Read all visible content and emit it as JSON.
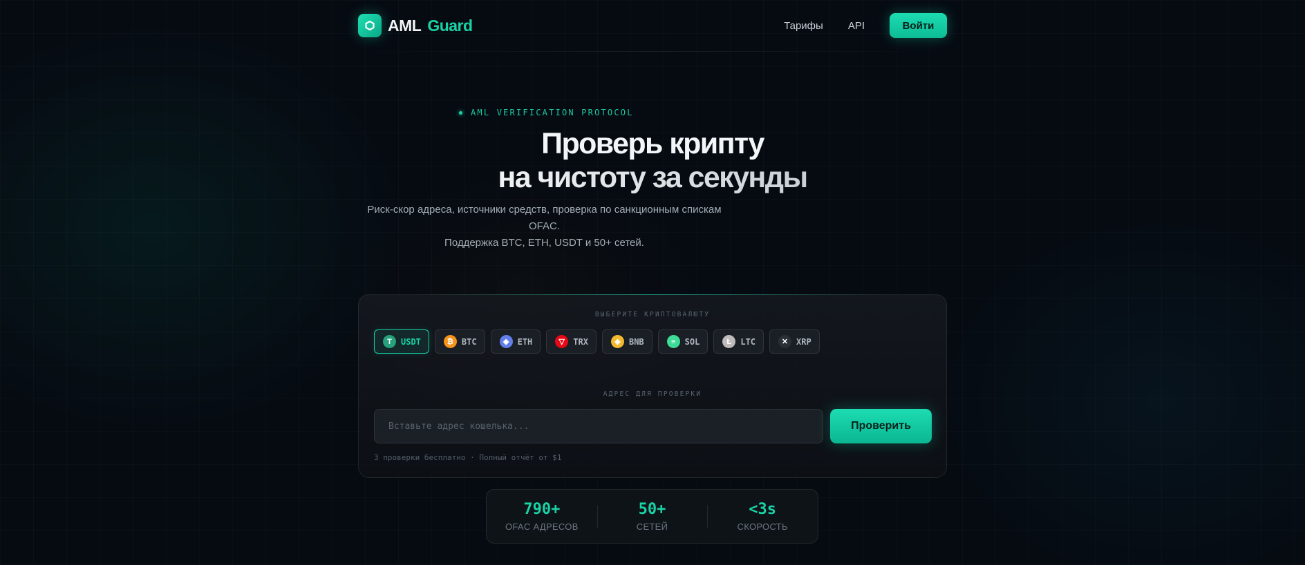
{
  "brand": {
    "name_primary": "AML",
    "name_accent": "Guard",
    "logo_icon": "hexagon-logo-icon"
  },
  "nav": {
    "links": [
      "Тарифы",
      "API"
    ],
    "login_label": "Войти"
  },
  "hero": {
    "eyebrow": "AML VERIFICATION PROTOCOL",
    "title_line1": "Проверь крипту",
    "title_line2": "на чистоту за секунды",
    "subtitle_line1": "Риск-скор адреса, источники средств, проверка по санкционным спискам OFAC.",
    "subtitle_line2": "Поддержка BTC, ETH, USDT и 50+ сетей."
  },
  "checker": {
    "currency_caption": "ВЫБЕРИТЕ КРИПТОВАЛЮТУ",
    "currencies": [
      {
        "label": "USDT",
        "icon": "usdt-icon",
        "color": "#26a17b",
        "glyph": "T",
        "active": true
      },
      {
        "label": "BTC",
        "icon": "btc-icon",
        "color": "#f7931a",
        "glyph": "₿",
        "active": false
      },
      {
        "label": "ETH",
        "icon": "eth-icon",
        "color": "#627eea",
        "glyph": "◆",
        "active": false
      },
      {
        "label": "TRX",
        "icon": "trx-icon",
        "color": "#e50915",
        "glyph": "▽",
        "active": false
      },
      {
        "label": "BNB",
        "icon": "bnb-icon",
        "color": "#f3ba2f",
        "glyph": "◈",
        "active": false
      },
      {
        "label": "SOL",
        "icon": "sol-icon",
        "color": "#3ddc97",
        "glyph": "≡",
        "active": false
      },
      {
        "label": "LTC",
        "icon": "ltc-icon",
        "color": "#bfbbbb",
        "glyph": "Ł",
        "active": false
      },
      {
        "label": "XRP",
        "icon": "xrp-icon",
        "color": "#2a2f36",
        "glyph": "✕",
        "active": false
      }
    ],
    "address_caption": "АДРЕС ДЛЯ ПРОВЕРКИ",
    "address_placeholder": "Вставьте адрес кошелька...",
    "address_value": "",
    "submit_label": "Проверить",
    "note": "3 проверки бесплатно · Полный отчёт от $1"
  },
  "stats": [
    {
      "value": "790+",
      "label": "OFAC АДРЕСОВ"
    },
    {
      "value": "50+",
      "label": "СЕТЕЙ"
    },
    {
      "value": "<3s",
      "label": "СКОРОСТЬ"
    }
  ],
  "colors": {
    "accent": "#19d3a6",
    "background": "#060b12",
    "card": "#14181e"
  }
}
